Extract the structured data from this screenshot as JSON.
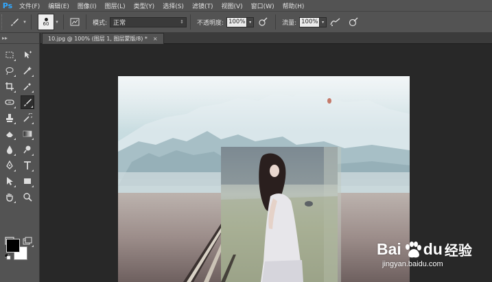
{
  "app": {
    "logo": "Ps"
  },
  "menu": [
    {
      "label": "文件(F)"
    },
    {
      "label": "编辑(E)"
    },
    {
      "label": "图像(I)"
    },
    {
      "label": "图层(L)"
    },
    {
      "label": "类型(Y)"
    },
    {
      "label": "选择(S)"
    },
    {
      "label": "滤镜(T)"
    },
    {
      "label": "视图(V)"
    },
    {
      "label": "窗口(W)"
    },
    {
      "label": "帮助(H)"
    }
  ],
  "options": {
    "tool_icon": "brush-icon",
    "brush_size": "60",
    "mode_label": "模式:",
    "mode_value": "正常",
    "opacity_label": "不透明度:",
    "opacity_value": "100%",
    "flow_label": "流量:",
    "flow_value": "100%"
  },
  "document": {
    "tab_title": "10.jpg @ 100% (图层 1, 图层蒙版/8) *",
    "close_glyph": "×"
  },
  "toolbar": {
    "active_tool": "brush-tool",
    "foreground_color": "#000000",
    "background_color": "#ffffff"
  },
  "watermark": {
    "brand": "Bai",
    "brand_suffix": "du",
    "cn": "经验",
    "url": "jingyan.baidu.com"
  },
  "colors": {
    "chrome": "#535353",
    "workspace": "#282828",
    "accent": "#31a8ff"
  }
}
